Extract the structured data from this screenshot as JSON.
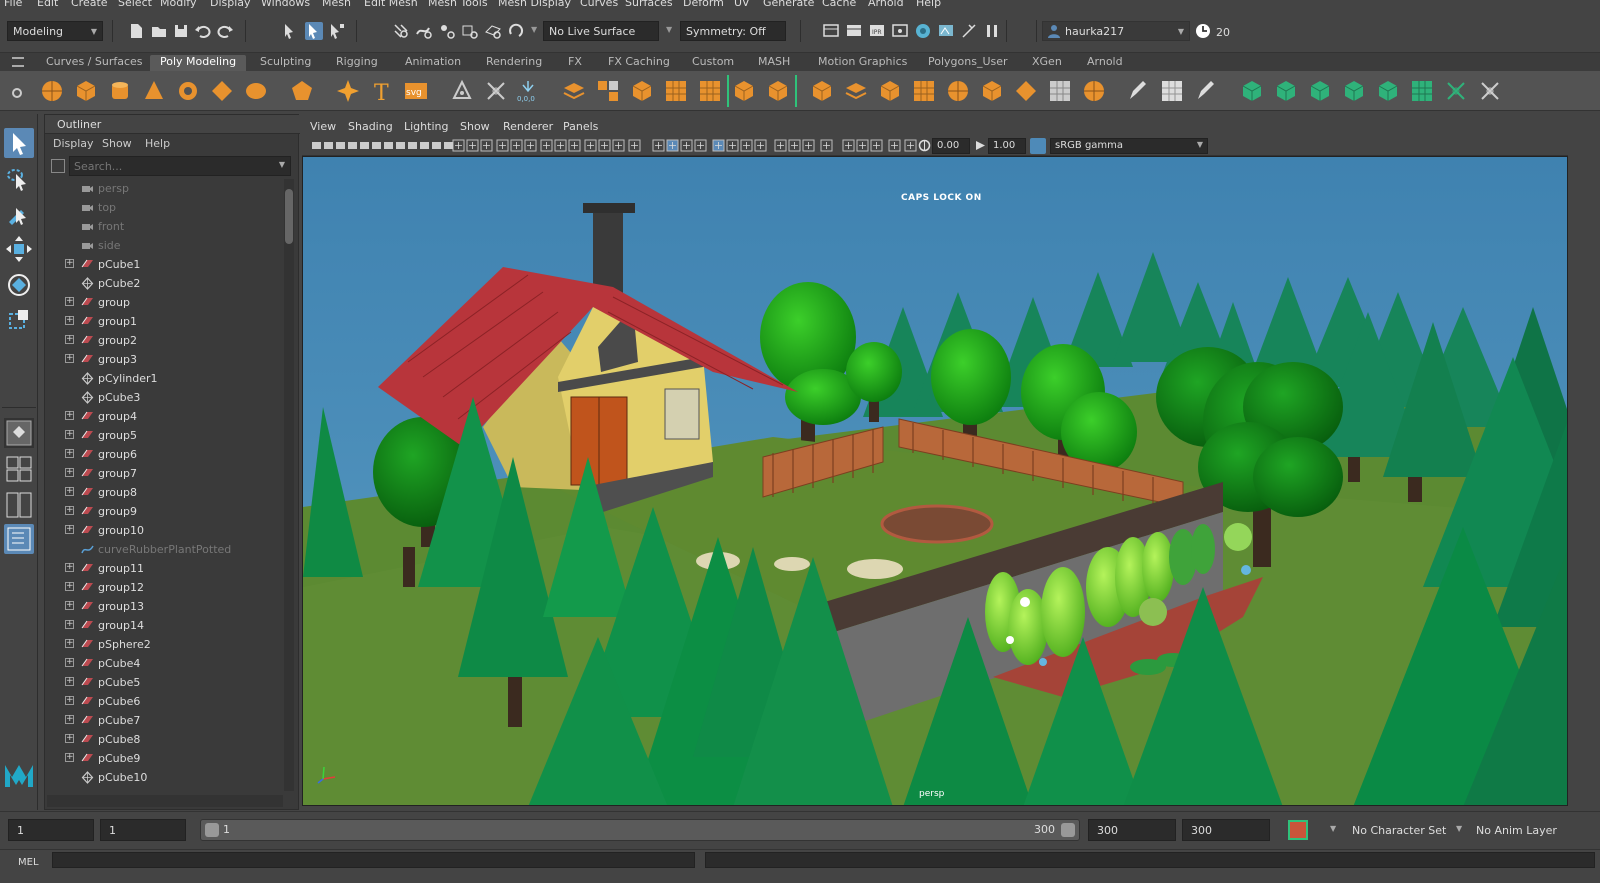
{
  "menubar": [
    "File",
    "Edit",
    "Create",
    "Select",
    "Modify",
    "Display",
    "Windows",
    "Mesh",
    "Edit Mesh",
    "Mesh Tools",
    "Mesh Display",
    "Curves",
    "Surfaces",
    "Deform",
    "UV",
    "Generate",
    "Cache",
    "Arnold",
    "Help"
  ],
  "status": {
    "menuset": "Modeling",
    "live_surface": "No Live Surface",
    "symmetry": "Symmetry: Off",
    "user": "haurka217",
    "credits": "20"
  },
  "shelf_tabs": [
    "Curves / Surfaces",
    "Poly Modeling",
    "Sculpting",
    "Rigging",
    "Animation",
    "Rendering",
    "FX",
    "FX Caching",
    "Custom",
    "MASH",
    "Motion Graphics",
    "Polygons_User",
    "XGen",
    "Arnold"
  ],
  "shelf_active": "Poly Modeling",
  "shelf_labels": {
    "text": "T",
    "svg": "svg",
    "coords": "0,0,0"
  },
  "outliner": {
    "title": "Outliner",
    "menu": [
      "Display",
      "Show",
      "Help"
    ],
    "search_placeholder": "Search...",
    "items": [
      {
        "label": "persp",
        "kind": "camera",
        "dim": true,
        "exp": false
      },
      {
        "label": "top",
        "kind": "camera",
        "dim": true,
        "exp": false
      },
      {
        "label": "front",
        "kind": "camera",
        "dim": true,
        "exp": false
      },
      {
        "label": "side",
        "kind": "camera",
        "dim": true,
        "exp": false
      },
      {
        "label": "pCube1",
        "kind": "mesh",
        "dim": false,
        "exp": true
      },
      {
        "label": "pCube2",
        "kind": "group",
        "dim": false,
        "exp": false
      },
      {
        "label": "group",
        "kind": "mesh",
        "dim": false,
        "exp": true
      },
      {
        "label": "group1",
        "kind": "mesh",
        "dim": false,
        "exp": true
      },
      {
        "label": "group2",
        "kind": "mesh",
        "dim": false,
        "exp": true
      },
      {
        "label": "group3",
        "kind": "mesh",
        "dim": false,
        "exp": true
      },
      {
        "label": "pCylinder1",
        "kind": "group",
        "dim": false,
        "exp": false
      },
      {
        "label": "pCube3",
        "kind": "group",
        "dim": false,
        "exp": false
      },
      {
        "label": "group4",
        "kind": "mesh",
        "dim": false,
        "exp": true
      },
      {
        "label": "group5",
        "kind": "mesh",
        "dim": false,
        "exp": true
      },
      {
        "label": "group6",
        "kind": "mesh",
        "dim": false,
        "exp": true
      },
      {
        "label": "group7",
        "kind": "mesh",
        "dim": false,
        "exp": true
      },
      {
        "label": "group8",
        "kind": "mesh",
        "dim": false,
        "exp": true
      },
      {
        "label": "group9",
        "kind": "mesh",
        "dim": false,
        "exp": true
      },
      {
        "label": "group10",
        "kind": "mesh",
        "dim": false,
        "exp": true
      },
      {
        "label": "curveRubberPlantPotted",
        "kind": "curve",
        "dim": true,
        "exp": false
      },
      {
        "label": "group11",
        "kind": "mesh",
        "dim": false,
        "exp": true
      },
      {
        "label": "group12",
        "kind": "mesh",
        "dim": false,
        "exp": true
      },
      {
        "label": "group13",
        "kind": "mesh",
        "dim": false,
        "exp": true
      },
      {
        "label": "group14",
        "kind": "mesh",
        "dim": false,
        "exp": true
      },
      {
        "label": "pSphere2",
        "kind": "mesh",
        "dim": false,
        "exp": true
      },
      {
        "label": "pCube4",
        "kind": "mesh",
        "dim": false,
        "exp": true
      },
      {
        "label": "pCube5",
        "kind": "mesh",
        "dim": false,
        "exp": true
      },
      {
        "label": "pCube6",
        "kind": "mesh",
        "dim": false,
        "exp": true
      },
      {
        "label": "pCube7",
        "kind": "mesh",
        "dim": false,
        "exp": true
      },
      {
        "label": "pCube8",
        "kind": "mesh",
        "dim": false,
        "exp": true
      },
      {
        "label": "pCube9",
        "kind": "mesh",
        "dim": false,
        "exp": true
      },
      {
        "label": "pCube10",
        "kind": "group",
        "dim": false,
        "exp": false
      }
    ]
  },
  "viewport": {
    "menu": [
      "View",
      "Shading",
      "Lighting",
      "Show",
      "Renderer",
      "Panels"
    ],
    "exposure": "0.00",
    "gamma": "1.00",
    "color_space": "sRGB gamma",
    "caps_lock": "CAPS LOCK ON",
    "camera": "persp"
  },
  "timebar": {
    "start": "1",
    "current_start": "1",
    "slider_start": "1",
    "slider_end": "300",
    "end": "300",
    "anim_end": "300",
    "character_set": "No Character Set",
    "anim_layer": "No Anim Layer"
  },
  "cmdline": {
    "mode": "MEL"
  },
  "colors": {
    "sky": "#4b8bb5",
    "grass": "#5c8a32",
    "pine": "#17855a",
    "roof": "#b8353b",
    "wall": "#e2cf6a",
    "fence": "#b8683a"
  }
}
